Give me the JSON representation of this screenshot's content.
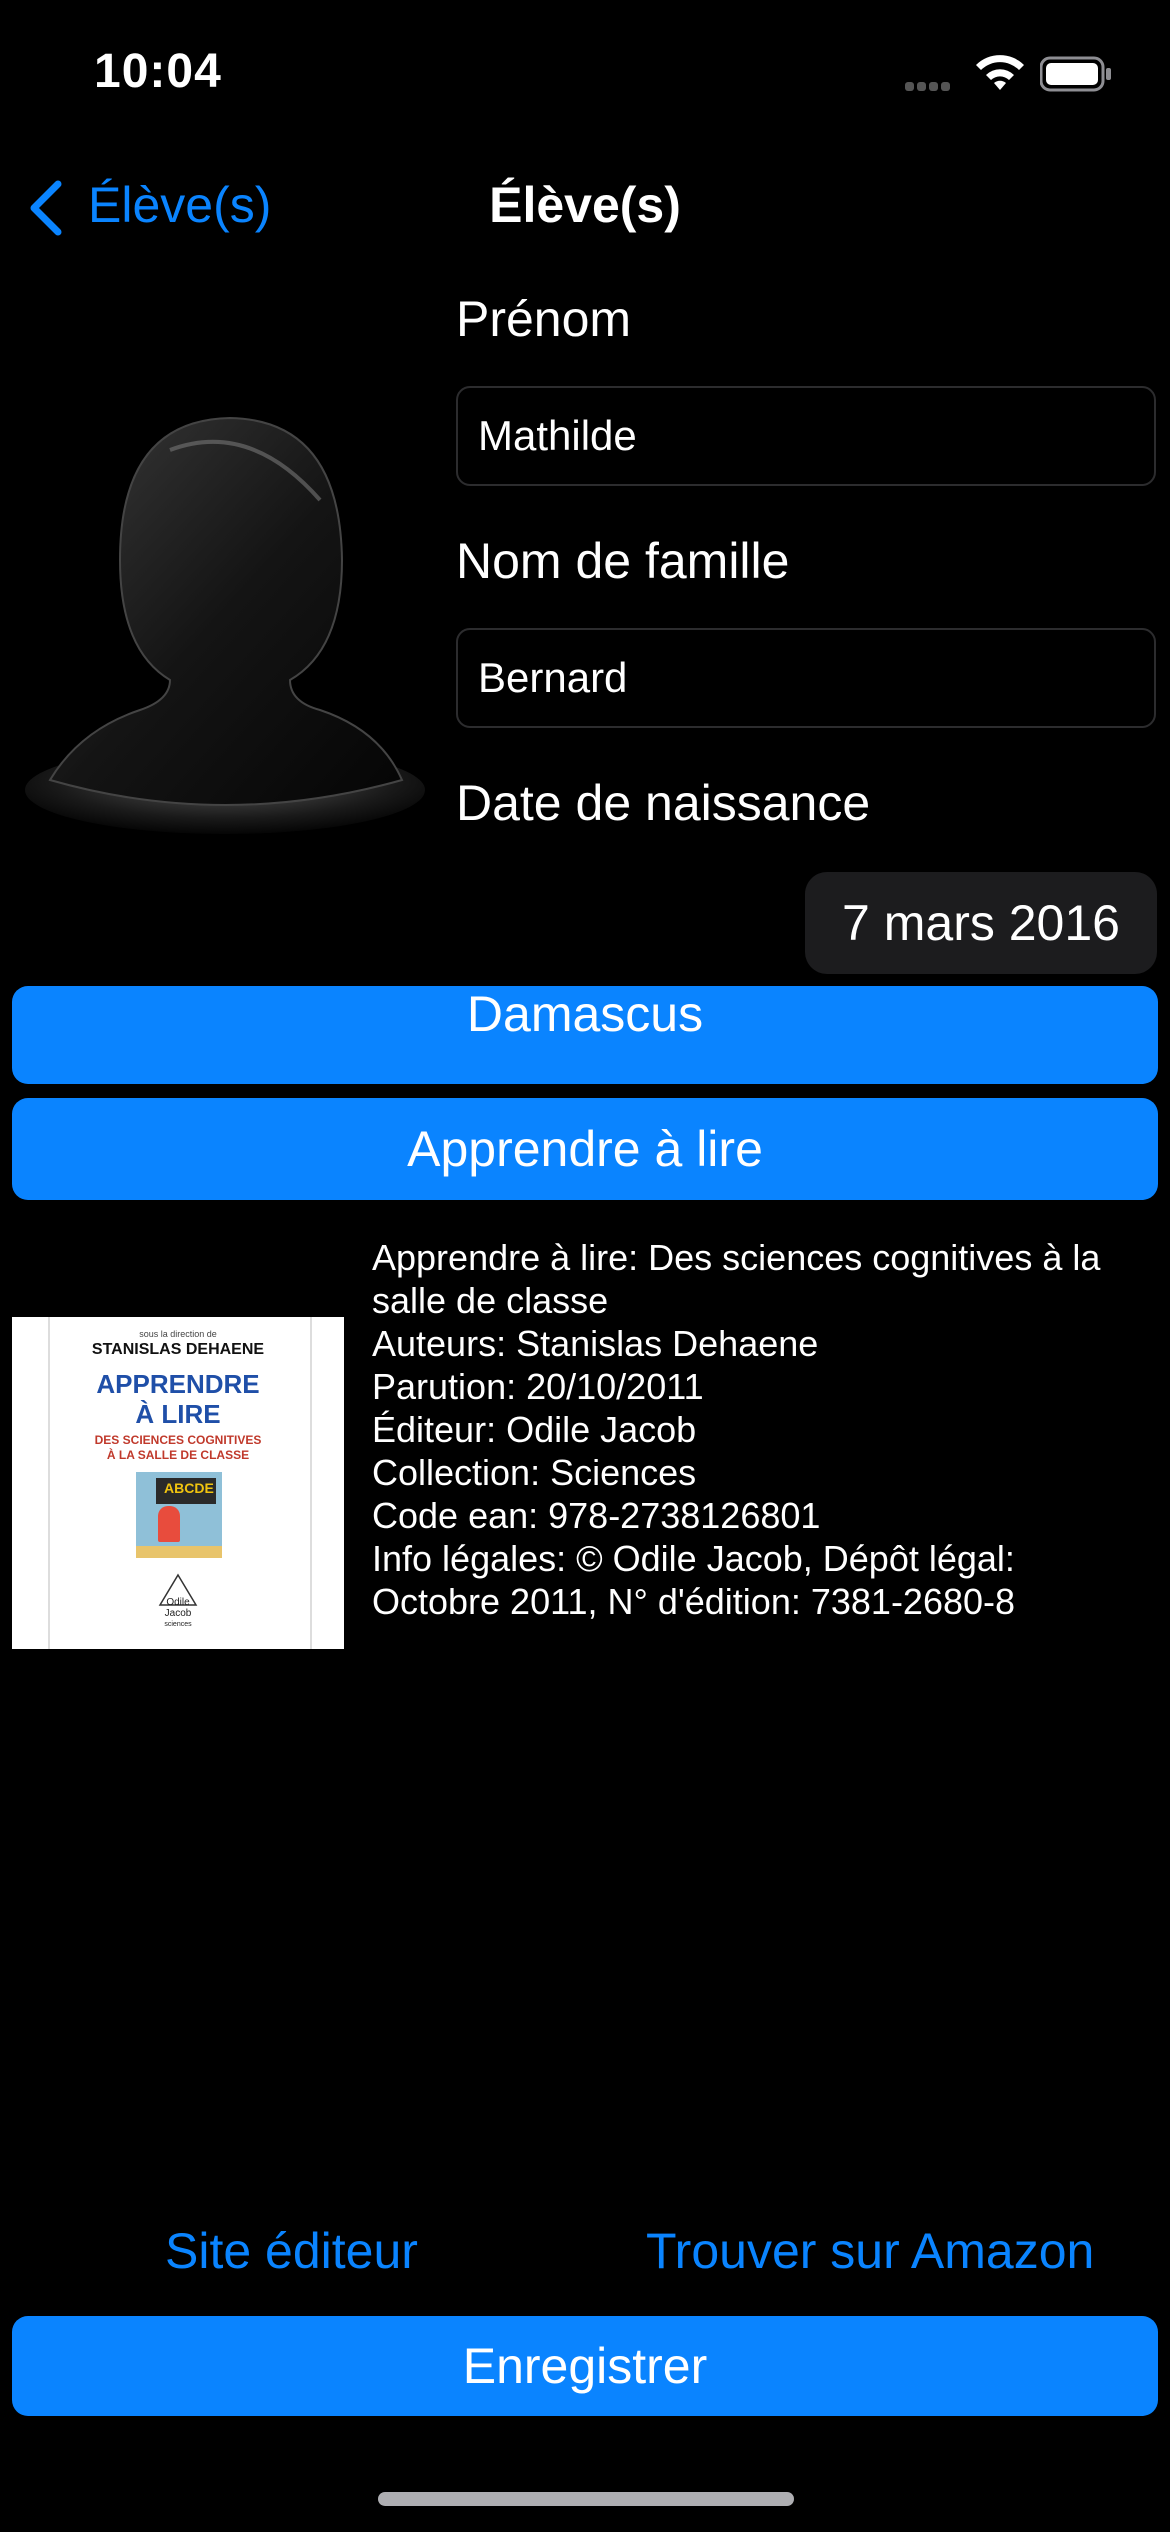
{
  "status_bar": {
    "time": "10:04"
  },
  "nav": {
    "back_label": "Élève(s)",
    "title": "Élève(s)"
  },
  "form": {
    "first_name_label": "Prénom",
    "first_name_value": "Mathilde",
    "last_name_label": "Nom de famille",
    "last_name_value": "Bernard",
    "birthdate_label": "Date de naissance",
    "birthdate_value": "7 mars 2016"
  },
  "buttons": {
    "damascus": "Damascus",
    "learn_to_read": "Apprendre à lire",
    "save": "Enregistrer"
  },
  "book": {
    "cover": {
      "director_line": "sous la direction de",
      "author": "STANISLAS DEHAENE",
      "title_line1": "APPRENDRE",
      "title_line2": "À LIRE",
      "subtitle_line1": "DES SCIENCES COGNITIVES",
      "subtitle_line2": "À LA SALLE DE CLASSE",
      "publisher_line1": "Odile",
      "publisher_line2": "Jacob",
      "series": "sciences"
    },
    "lines": [
      "Apprendre à lire: Des sciences cognitives à la salle de classe",
      "Auteurs: Stanislas Dehaene",
      "Parution: 20/10/2011",
      "Éditeur: Odile Jacob",
      "Collection: Sciences",
      "Code ean: 978-2738126801",
      "Info légales:  © Odile Jacob, Dépôt légal: Octobre 2011, N° d'édition: 7381-2680-8"
    ]
  },
  "links": {
    "publisher_site": "Site éditeur",
    "amazon": "Trouver sur Amazon"
  },
  "colors": {
    "accent": "#0a84ff",
    "background": "#000000",
    "field_border": "#2c2c2e"
  }
}
